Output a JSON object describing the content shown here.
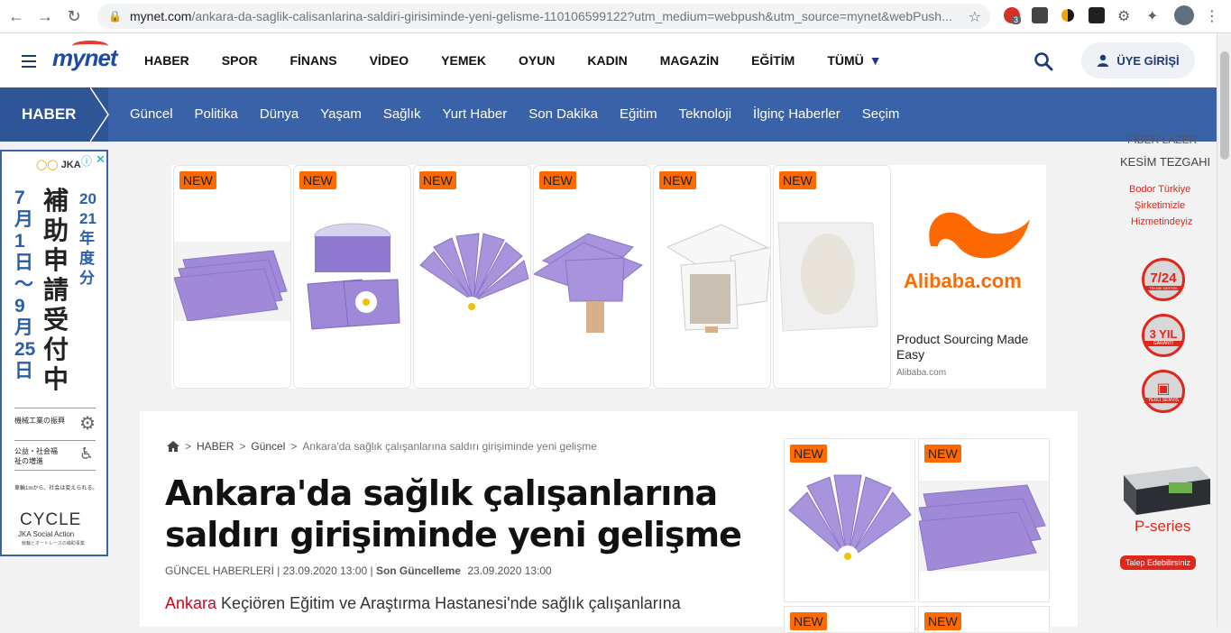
{
  "browser": {
    "url_host": "mynet.com",
    "url_path": "/ankara-da-saglik-calisanlarina-saldiri-girisiminde-yeni-gelisme-110106599122?utm_medium=webpush&utm_source=mynet&webPush...",
    "ext_badge": "3"
  },
  "header": {
    "logo": "mynet",
    "nav": [
      "HABER",
      "SPOR",
      "FİNANS",
      "VİDEO",
      "YEMEK",
      "OYUN",
      "KADIN",
      "MAGAZİN",
      "EĞİTİM",
      "TÜMÜ"
    ],
    "login_label": "ÜYE GİRİŞİ"
  },
  "catbar": {
    "section": "HABER",
    "items": [
      "Güncel",
      "Politika",
      "Dünya",
      "Yaşam",
      "Sağlık",
      "Yurt Haber",
      "Son Dakika",
      "Eğitim",
      "Teknoloji",
      "İlginç Haberler",
      "Seçim"
    ]
  },
  "left_ad": {
    "brand": "JKA",
    "col1": "7月1日～9月25日",
    "col2": "補助申請受付中",
    "col3": "2021年度分",
    "row1": "機械工業の振興",
    "row2": "公益・社会福祉の増進",
    "tagline": "車輪1mから、社会は変えられる。",
    "cycle": "CYCLE",
    "cycle_sub": "JKA Social Action",
    "cycle_sub2": "競輪とオートレースの補助事業"
  },
  "top_ad": {
    "badge": "NEW",
    "alibaba_logo": "Alibaba.com",
    "alibaba_text": "Product Sourcing Made Easy",
    "alibaba_domain": "Alibaba.com"
  },
  "article": {
    "breadcrumb": [
      "HABER",
      "Güncel",
      "Ankara'da sağlık çalışanlarına saldırı girişiminde yeni gelişme"
    ],
    "title": "Ankara'da sağlık çalışanlarına saldırı girişiminde yeni gelişme",
    "category": "GÜNCEL HABERLERİ",
    "date": "23.09.2020 13:00",
    "updated_label": "Son Güncelleme",
    "updated_date": "23.09.2020 13:00",
    "lead_link": "Ankara",
    "lead_text": " Keçiören Eğitim ve Araştırma Hastanesi'nde sağlık çalışanlarına"
  },
  "right_sky": {
    "line1": "FİBER LAZER",
    "line2": "KESİM TEZGAHI",
    "tag1": "Bodor Türkiye",
    "tag2": "Şirketimizle",
    "tag3": "Hizmetindeyiz",
    "badge1": "7/24",
    "badge1_sub": "TEKNİK DESTEK",
    "badge2": "3 YIL",
    "badge2_sub": "GARANTİ",
    "badge3_sub": "YERLİ SERVİS",
    "product": "P-series",
    "cta": "Talep Edebilirsiniz"
  },
  "colors": {
    "brand_blue": "#3a62a8",
    "dark_blue": "#2f5597",
    "new_orange": "#ff6a00",
    "purple": "#9b87d6",
    "link_red": "#d0021b"
  }
}
